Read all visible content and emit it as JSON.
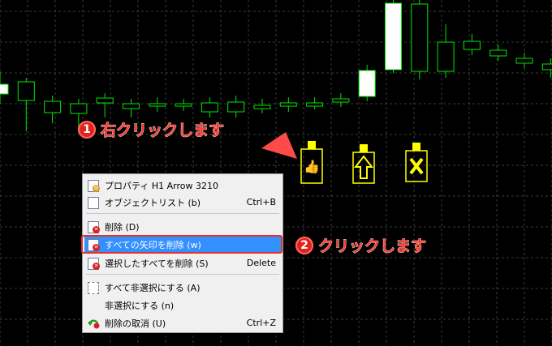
{
  "chart": {
    "grid_color": "#3a3a3a",
    "bull_color": "#ffffff",
    "bear_color": "#000000",
    "outline_color": "#00e600",
    "candles": [
      {
        "o": 116,
        "c": 104,
        "h": 88,
        "l": 128
      },
      {
        "o": 101,
        "c": 124,
        "h": 96,
        "l": 162
      },
      {
        "o": 125,
        "c": 139,
        "h": 118,
        "l": 152
      },
      {
        "o": 128,
        "c": 140,
        "h": 122,
        "l": 160
      },
      {
        "o": 121,
        "c": 127,
        "h": 115,
        "l": 145
      },
      {
        "o": 128,
        "c": 134,
        "h": 122,
        "l": 145
      },
      {
        "o": 128,
        "c": 131,
        "h": 120,
        "l": 138
      },
      {
        "o": 128,
        "c": 131,
        "h": 122,
        "l": 137
      },
      {
        "o": 127,
        "c": 138,
        "h": 120,
        "l": 145
      },
      {
        "o": 126,
        "c": 138,
        "h": 118,
        "l": 145
      },
      {
        "o": 130,
        "c": 134,
        "h": 122,
        "l": 140
      },
      {
        "o": 127,
        "c": 131,
        "h": 120,
        "l": 138
      },
      {
        "o": 127,
        "c": 131,
        "h": 120,
        "l": 135
      },
      {
        "o": 122,
        "c": 126,
        "h": 115,
        "l": 132
      },
      {
        "o": 119,
        "c": 87,
        "h": 80,
        "l": 125
      },
      {
        "o": 86,
        "c": 4,
        "h": 0,
        "l": 90
      },
      {
        "o": 5,
        "c": 88,
        "h": 0,
        "l": 98
      },
      {
        "o": 52,
        "c": 88,
        "h": 30,
        "l": 96
      },
      {
        "o": 51,
        "c": 61,
        "h": 42,
        "l": 68
      },
      {
        "o": 62,
        "c": 69,
        "h": 55,
        "l": 75
      },
      {
        "o": 72,
        "c": 78,
        "h": 65,
        "l": 84
      },
      {
        "o": 79,
        "c": 86,
        "h": 72,
        "l": 96
      },
      {
        "o": 79,
        "c": 64,
        "h": 58,
        "l": 85
      },
      {
        "o": 61,
        "c": 83,
        "h": 52,
        "l": 90
      }
    ]
  },
  "arrows": [
    {
      "name": "thumbs-up-arrow-icon",
      "glyph": "👍"
    },
    {
      "name": "up-arrow-icon",
      "glyph": "⇧"
    },
    {
      "name": "cross-arrow-icon",
      "glyph": "✖"
    }
  ],
  "callout1": {
    "number": "1",
    "text": "右クリックします"
  },
  "callout2": {
    "number": "2",
    "text": "クリックします"
  },
  "menu": {
    "items": [
      {
        "label": "プロパティ H1 Arrow 3210",
        "shortcut": "",
        "icon": "properties-icon"
      },
      {
        "label": "オブジェクトリスト (b)",
        "shortcut": "Ctrl+B",
        "icon": "object-list-icon"
      },
      {
        "label": "削除 (D)",
        "shortcut": "",
        "icon": "delete-icon"
      },
      {
        "label": "すべての矢印を削除 (w)",
        "shortcut": "",
        "icon": "delete-all-arrows-icon"
      },
      {
        "label": "選択したすべてを削除 (S)",
        "shortcut": "Delete",
        "icon": "delete-selected-icon"
      },
      {
        "label": "すべて非選択にする (A)",
        "shortcut": "",
        "icon": "deselect-all-icon"
      },
      {
        "label": "非選択にする (n)",
        "shortcut": "",
        "icon": ""
      },
      {
        "label": "削除の取消 (U)",
        "shortcut": "Ctrl+Z",
        "icon": "undo-delete-icon"
      }
    ]
  }
}
